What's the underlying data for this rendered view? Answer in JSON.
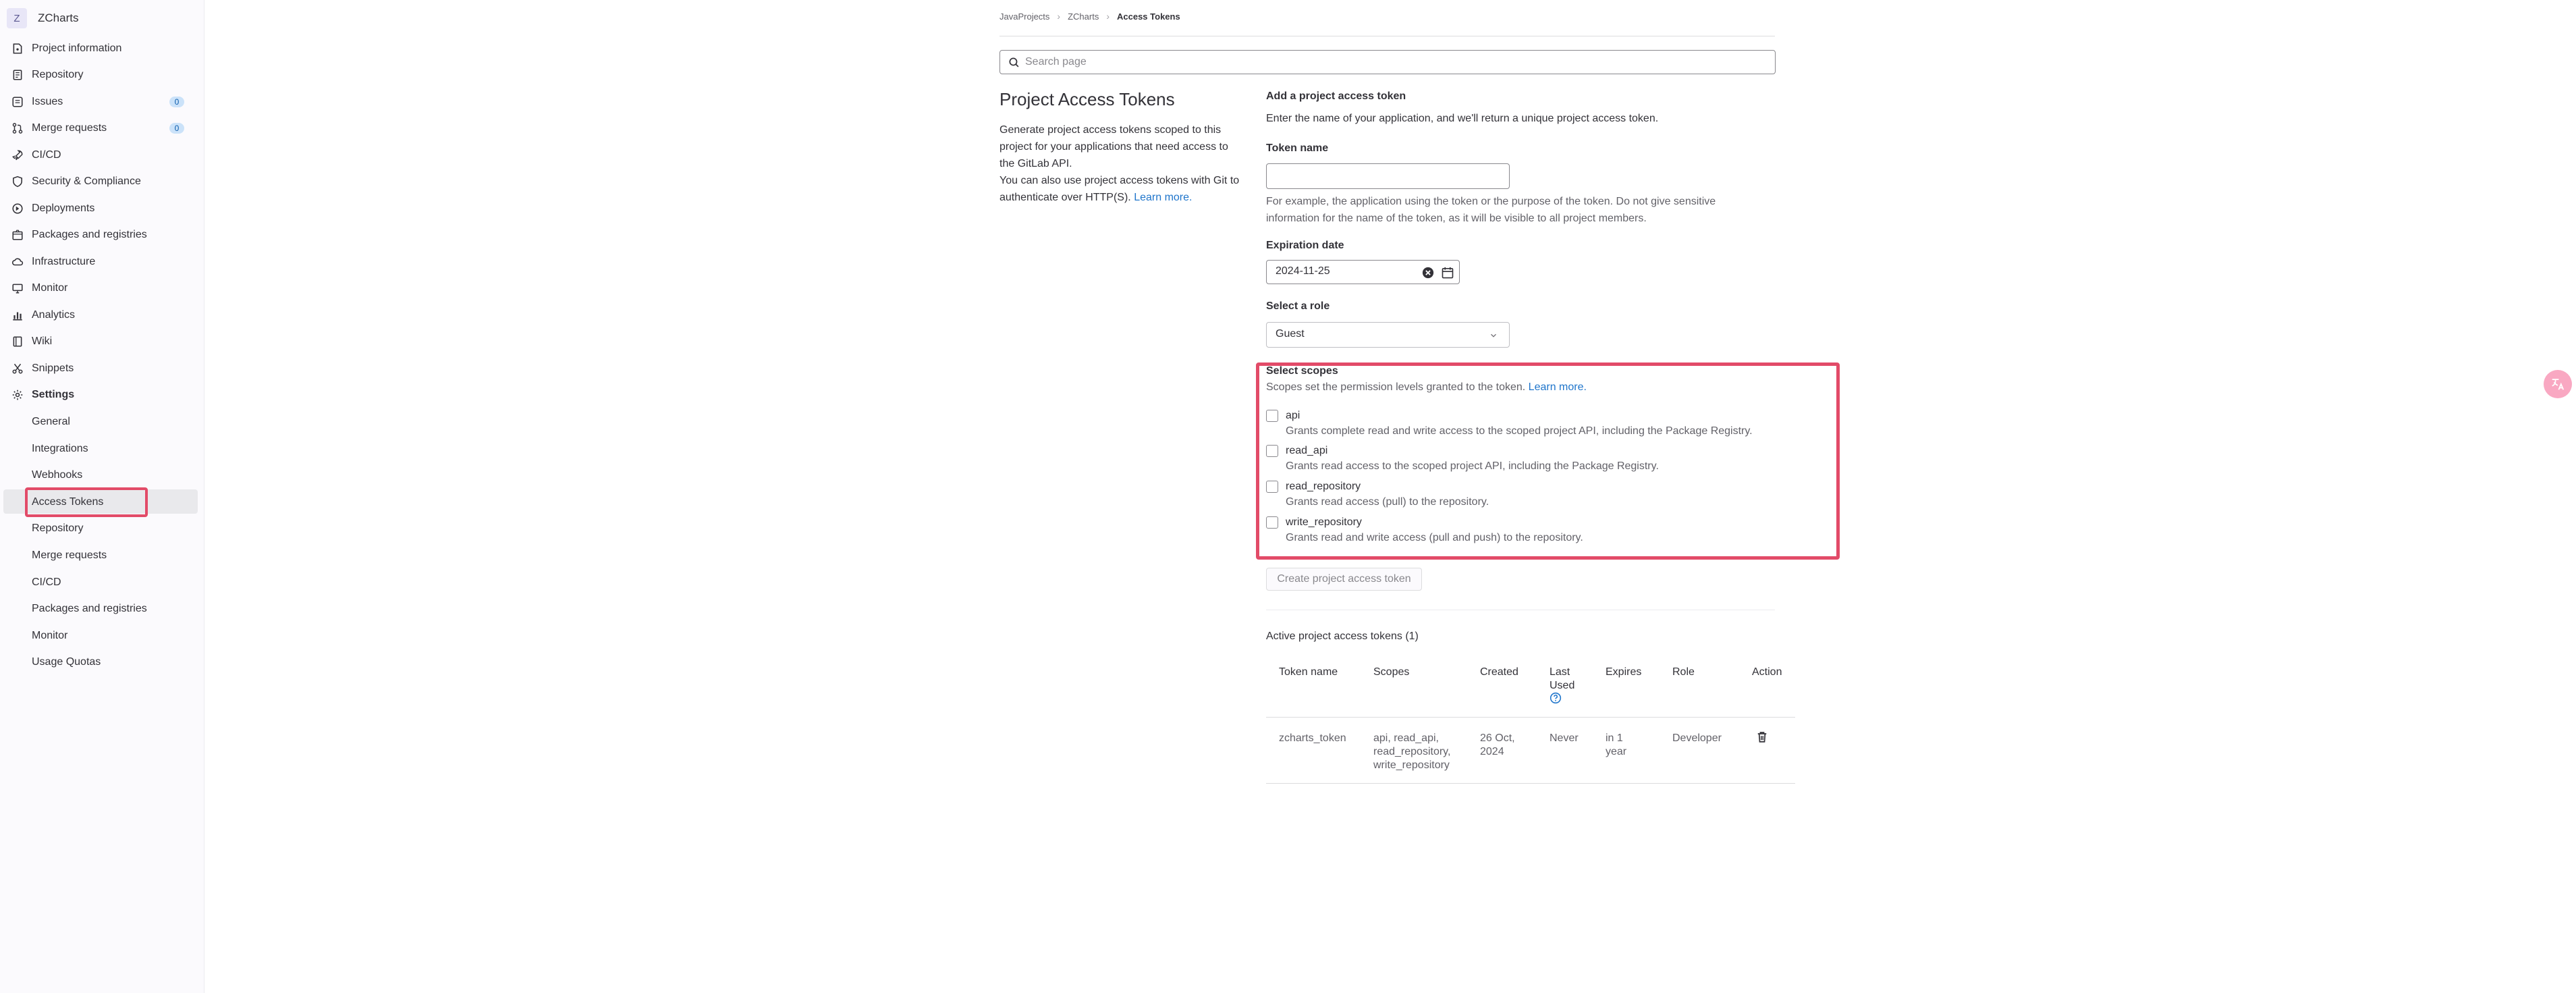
{
  "project": {
    "avatar_letter": "Z",
    "name": "ZCharts"
  },
  "sidebar": {
    "items": [
      {
        "label": "Project information",
        "icon": "project-icon"
      },
      {
        "label": "Repository",
        "icon": "doc-icon"
      },
      {
        "label": "Issues",
        "icon": "issues-icon",
        "count": "0"
      },
      {
        "label": "Merge requests",
        "icon": "merge-request-icon",
        "count": "0"
      },
      {
        "label": "CI/CD",
        "icon": "rocket-icon"
      },
      {
        "label": "Security & Compliance",
        "icon": "shield-icon"
      },
      {
        "label": "Deployments",
        "icon": "deployments-icon"
      },
      {
        "label": "Packages and registries",
        "icon": "package-icon"
      },
      {
        "label": "Infrastructure",
        "icon": "cloud-icon"
      },
      {
        "label": "Monitor",
        "icon": "monitor-icon"
      },
      {
        "label": "Analytics",
        "icon": "chart-icon"
      },
      {
        "label": "Wiki",
        "icon": "book-icon"
      },
      {
        "label": "Snippets",
        "icon": "snippet-icon"
      },
      {
        "label": "Settings",
        "icon": "settings-icon"
      }
    ],
    "settings_sub": [
      "General",
      "Integrations",
      "Webhooks",
      "Access Tokens",
      "Repository",
      "Merge requests",
      "CI/CD",
      "Packages and registries",
      "Monitor",
      "Usage Quotas"
    ]
  },
  "breadcrumb": [
    "JavaProjects",
    "ZCharts",
    "Access Tokens"
  ],
  "search": {
    "placeholder": "Search page"
  },
  "page": {
    "title": "Project Access Tokens",
    "desc_1": "Generate project access tokens scoped to this project for your applications that need access to the GitLab API.",
    "desc_2": "You can also use project access tokens with Git to authenticate over HTTP(S).",
    "learn_more": "Learn more."
  },
  "form": {
    "heading": "Add a project access token",
    "intro": "Enter the name of your application, and we'll return a unique project access token.",
    "token_name_label": "Token name",
    "token_name_value": "",
    "token_help": "For example, the application using the token or the purpose of the token. Do not give sensitive information for the name of the token, as it will be visible to all project members.",
    "expiration_label": "Expiration date",
    "expiration_value": "2024-11-25",
    "role_label": "Select a role",
    "role_value": "Guest",
    "scopes_label": "Select scopes",
    "scopes_help": "Scopes set the permission levels granted to the token.",
    "scopes_learn_more": "Learn more.",
    "scopes": [
      {
        "name": "api",
        "desc": "Grants complete read and write access to the scoped project API, including the Package Registry."
      },
      {
        "name": "read_api",
        "desc": "Grants read access to the scoped project API, including the Package Registry."
      },
      {
        "name": "read_repository",
        "desc": "Grants read access (pull) to the repository."
      },
      {
        "name": "write_repository",
        "desc": "Grants read and write access (pull and push) to the repository."
      }
    ],
    "create_button": "Create project access token"
  },
  "active_tokens": {
    "heading": "Active project access tokens (1)",
    "columns": [
      "Token name",
      "Scopes",
      "Created",
      "Last Used",
      "Expires",
      "Role",
      "Action"
    ],
    "rows": [
      {
        "token_name": "zcharts_token",
        "scopes": "api, read_api, read_repository, write_repository",
        "created": "26 Oct, 2024",
        "last_used": "Never",
        "expires": "in 1 year",
        "role": "Developer"
      }
    ]
  }
}
